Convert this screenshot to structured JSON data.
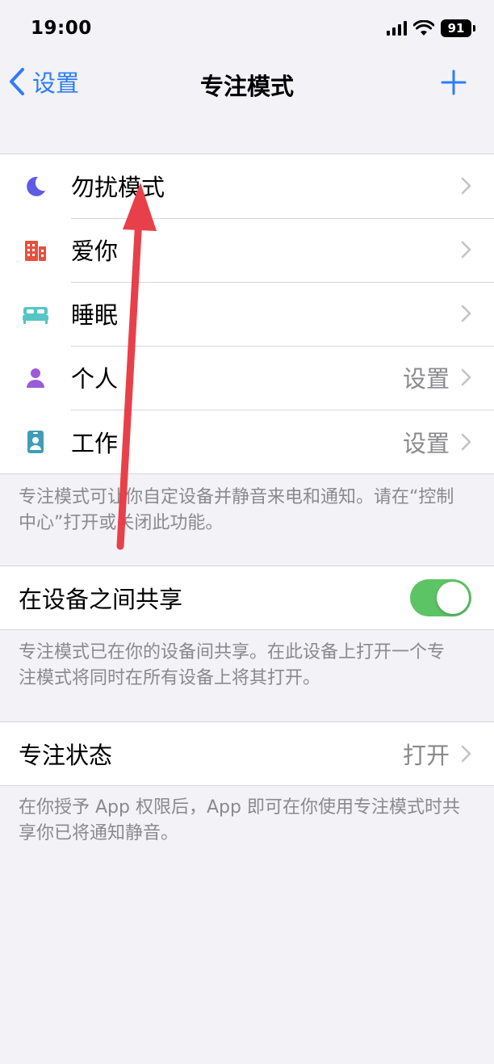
{
  "status": {
    "time": "19:00",
    "battery": "91"
  },
  "nav": {
    "back_label": "设置",
    "title": "专注模式"
  },
  "focus_modes": [
    {
      "label": "勿扰模式",
      "value": "",
      "icon": "moon-icon",
      "color": "#5e5ce6"
    },
    {
      "label": "爱你",
      "value": "",
      "icon": "building-icon",
      "color": "#e5503e"
    },
    {
      "label": "睡眠",
      "value": "",
      "icon": "bed-icon",
      "color": "#56c5c5"
    },
    {
      "label": "个人",
      "value": "设置",
      "icon": "person-icon",
      "color": "#9c5bd6"
    },
    {
      "label": "工作",
      "value": "设置",
      "icon": "id-badge-icon",
      "color": "#3f9db8"
    }
  ],
  "focus_note": "专注模式可让你自定设备并静音来电和通知。请在“控制中心”打开或关闭此功能。",
  "share": {
    "label": "在设备之间共享",
    "enabled": true
  },
  "share_note": "专注模式已在你的设备间共享。在此设备上打开一个专注模式将同时在所有设备上将其打开。",
  "focus_status": {
    "label": "专注状态",
    "value": "打开"
  },
  "status_note": "在你授予 App 权限后，App 即可在你使用专注模式时共享你已将通知静音。",
  "colors": {
    "accent": "#2f7cf6",
    "toggle_on": "#5dc466",
    "annotation_arrow": "#e8404a"
  }
}
